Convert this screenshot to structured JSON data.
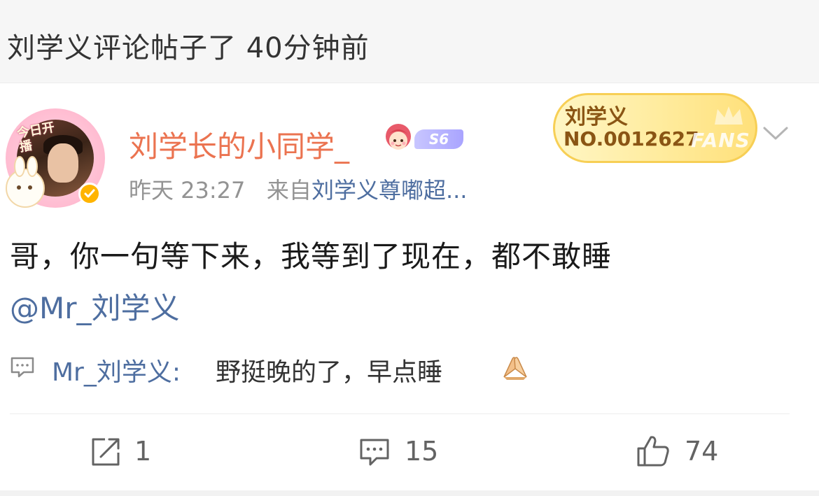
{
  "activity": {
    "text": "刘学义评论帖子了 40分钟前"
  },
  "post": {
    "avatar": {
      "frame_label": "今日开播",
      "verified_icon": "verified-check-icon"
    },
    "username": "刘学长的小同学_",
    "level_badge": "S6",
    "timestamp": "昨天 23:27",
    "source_prefix": "来自",
    "source": "刘学义尊嘟超...",
    "fans_badge": {
      "name": "刘学义",
      "number": "NO.0012627",
      "label": "FANS"
    },
    "text": "哥，你一句等下来，我等到了现在，都不敢睡",
    "mention": "@Mr_刘学义"
  },
  "reply": {
    "author": "Mr_刘学义:",
    "text": "野挺晚的了，早点睡"
  },
  "actions": {
    "repost_count": "1",
    "comment_count": "15",
    "like_count": "74"
  },
  "colors": {
    "username": "#eb7350",
    "link": "#4e6ea0",
    "meta": "#939393",
    "fans_text": "#8a5514",
    "fans_bg": "#ffeb9c"
  }
}
